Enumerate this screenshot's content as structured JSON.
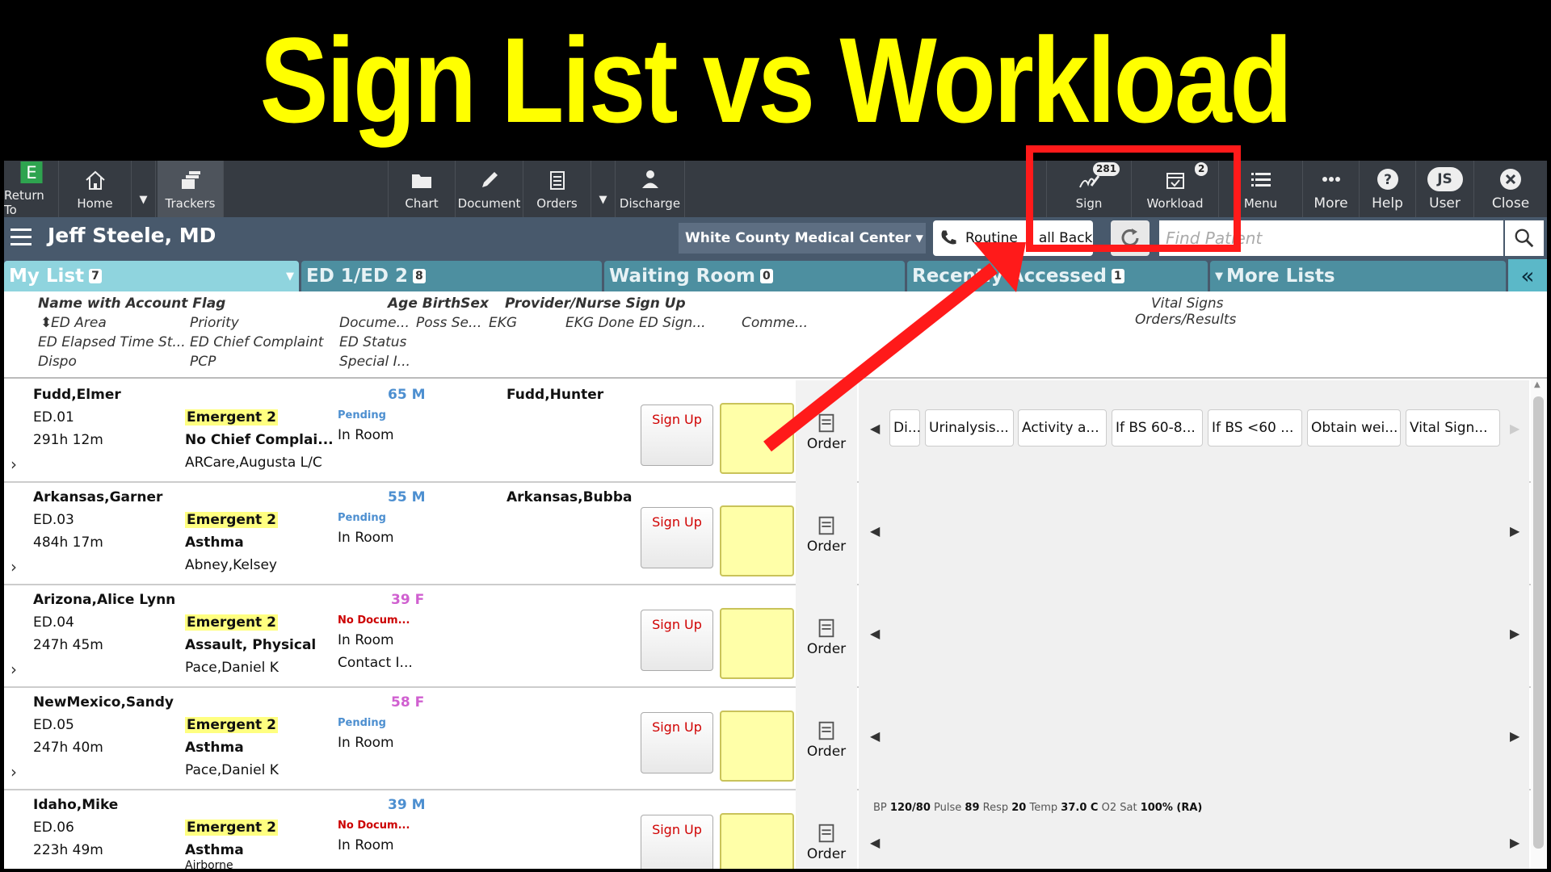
{
  "banner": {
    "title": "Sign List vs Workload"
  },
  "toolbar": {
    "return_to": "Return To",
    "home": "Home",
    "trackers": "Trackers",
    "chart": "Chart",
    "document": "Document",
    "orders": "Orders",
    "discharge": "Discharge",
    "sign": "Sign",
    "sign_badge": "281",
    "workload": "Workload",
    "workload_badge": "2",
    "menu": "Menu",
    "more": "More",
    "help": "Help",
    "user": "User",
    "user_initials": "JS",
    "close": "Close"
  },
  "header": {
    "provider": "Jeff Steele, MD",
    "facility": "White County Medical Center",
    "routine": "Routine",
    "call_back": "all Back",
    "find_placeholder": "Find Patient"
  },
  "tabs": [
    {
      "label": "My List",
      "count": "7"
    },
    {
      "label": "ED 1/ED 2",
      "count": "8"
    },
    {
      "label": "Waiting Room",
      "count": "0"
    },
    {
      "label": "Recently Accessed",
      "count": "1"
    },
    {
      "label": "More Lists"
    }
  ],
  "columns": {
    "name": "Name with Account Flag",
    "age": "Age BirthSex",
    "provider": "Provider/Nurse Sign Up",
    "vitals": "Vital Signs",
    "orders_results": "Orders/Results",
    "ed_area": "ED Area",
    "priority": "Priority",
    "docume": "Docume...",
    "poss": "Poss Se...",
    "ekg": "EKG",
    "ekg_done": "EKG Done",
    "ed_sign": "ED Sign...",
    "comme": "Comme...",
    "elapsed": "ED Elapsed Time St...",
    "complaint": "ED Chief Complaint",
    "status": "ED Status",
    "dispo": "Dispo",
    "pcp": "PCP",
    "special": "Special I..."
  },
  "actions": {
    "sign_up": "Sign Up",
    "order": "Order"
  },
  "patients": [
    {
      "name": "Fudd,Elmer",
      "area": "ED.01",
      "elapsed": "291h 12m",
      "priority": "Emergent 2",
      "complaint": "No Chief Complai...",
      "pcp": "ARCare,Augusta L/C",
      "age": "65 M",
      "doc": "Pending",
      "status": "In Room",
      "extra": "",
      "provider": "Fudd,Hunter"
    },
    {
      "name": "Arkansas,Garner",
      "area": "ED.03",
      "elapsed": "484h 17m",
      "priority": "Emergent 2",
      "complaint": "Asthma",
      "pcp": "Abney,Kelsey",
      "age": "55 M",
      "doc": "Pending",
      "status": "In Room",
      "extra": "",
      "provider": "Arkansas,Bubba"
    },
    {
      "name": "Arizona,Alice Lynn",
      "area": "ED.04",
      "elapsed": "247h 45m",
      "priority": "Emergent 2",
      "complaint": "Assault, Physical",
      "pcp": "Pace,Daniel K",
      "age": "39 F",
      "doc": "No Docum...",
      "status": "In Room",
      "extra": "Contact I...",
      "provider": ""
    },
    {
      "name": "NewMexico,Sandy",
      "area": "ED.05",
      "elapsed": "247h 40m",
      "priority": "Emergent 2",
      "complaint": "Asthma",
      "pcp": "Pace,Daniel K",
      "age": "58 F",
      "doc": "Pending",
      "status": "In Room",
      "extra": "",
      "provider": ""
    },
    {
      "name": "Idaho,Mike",
      "area": "ED.06",
      "elapsed": "223h 49m",
      "priority": "Emergent 2",
      "complaint": "Asthma",
      "pcp": "Airborne",
      "age": "39 M",
      "doc": "No Docum...",
      "status": "In Room",
      "extra": "",
      "provider": ""
    }
  ],
  "order_chips": [
    "Di...",
    "Urinalysis...",
    "Activity a...",
    "If BS 60-8...",
    "If BS <60 ...",
    "Obtain wei...",
    "Vital Sign..."
  ],
  "vitals": {
    "bp_label": "BP",
    "bp": "120/80",
    "pulse_label": "Pulse",
    "pulse": "89",
    "resp_label": "Resp",
    "resp": "20",
    "temp_label": "Temp",
    "temp": "37.0 C",
    "o2_label": "O2 Sat",
    "o2": "100% (RA)"
  },
  "colors": {
    "toolbar": "#363b42",
    "header": "#48596c",
    "tab": "#4d8fa0",
    "active_tab": "#8fd4de",
    "priority": "#ffff80",
    "highlight": "#ff1a1a",
    "banner_text": "#ffff00"
  }
}
